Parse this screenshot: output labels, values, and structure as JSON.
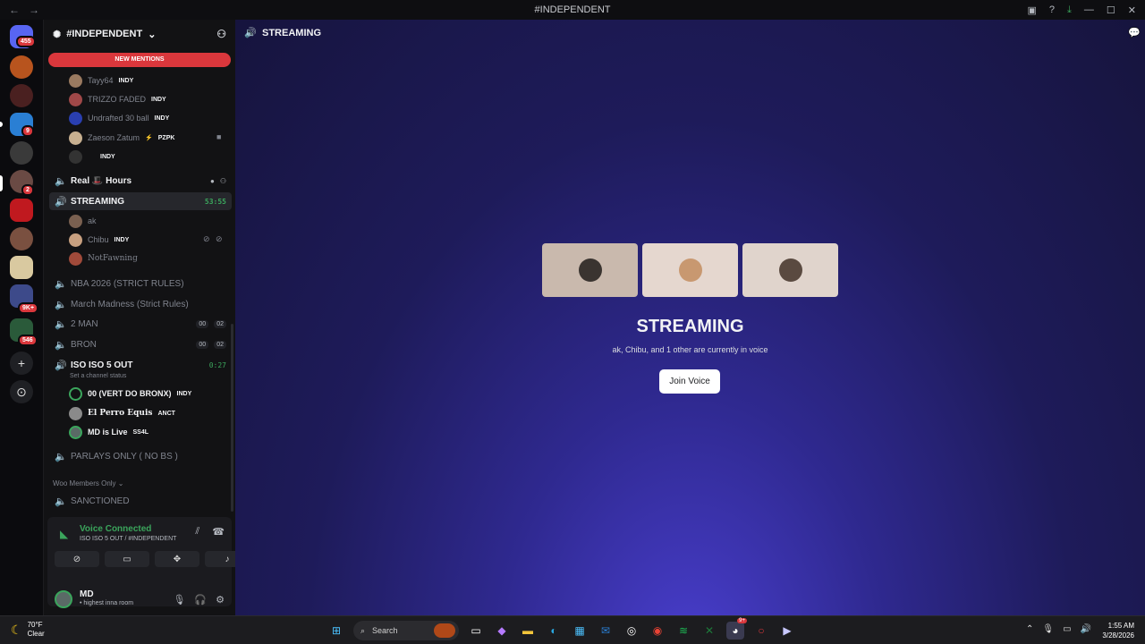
{
  "window": {
    "title": "#INDEPENDENT",
    "nav_back": "←",
    "nav_forward": "→",
    "icons": [
      "screen-share-icon",
      "help-icon",
      "download-icon",
      "minimize-icon",
      "maximize-icon",
      "close-icon"
    ],
    "controls": [
      "?",
      "⤓",
      "—",
      "☐",
      "✕"
    ]
  },
  "servers": {
    "badges": [
      "455",
      "9",
      "2",
      "9K+",
      "546"
    ],
    "add_label": "+",
    "discover_label": "⊙"
  },
  "guild": {
    "name": "#INDEPENDENT",
    "new_mentions": "NEW MENTIONS"
  },
  "top_users": [
    {
      "name": "Tayy64",
      "tag": "INDY"
    },
    {
      "name": "TRIZZO FADED",
      "tag": "INDY"
    },
    {
      "name": "Undrafted 30 ball",
      "tag": "INDY"
    },
    {
      "name": "Zaeson Zatum",
      "tag": "PZPK"
    },
    {
      "name": "",
      "tag": "INDY"
    }
  ],
  "channels": {
    "real_hours": "Real 🎩 Hours",
    "streaming": {
      "name": "STREAMING",
      "timer": "53:55"
    },
    "streaming_users": [
      {
        "name": "ak",
        "tag": ""
      },
      {
        "name": "Chibu",
        "tag": "INDY"
      },
      {
        "name": "NotFawning",
        "tag": ""
      }
    ],
    "nba": "NBA 2026 (STRICT RULES)",
    "march": "March Madness (Strict Rules)",
    "two_man": {
      "name": "2 MAN",
      "a": "00",
      "b": "02"
    },
    "bron": {
      "name": "BRON",
      "a": "00",
      "b": "02"
    },
    "iso": {
      "name": "ISO ISO 5 OUT",
      "timer": "0:27",
      "status": "Set a channel status"
    },
    "iso_users": [
      {
        "name": "00 (VERT DO BRONX)",
        "tag": "INDY"
      },
      {
        "name": "El Perro Equis",
        "tag": "ANCT"
      },
      {
        "name": "MD is Live",
        "tag": "SS4L"
      }
    ],
    "parlays": "PARLAYS ONLY ( NO BS )",
    "category_woo": "Woo Members Only",
    "sanctioned": "SANCTIONED"
  },
  "voice": {
    "title": "Voice Connected",
    "sub": "ISO ISO 5 OUT / #INDEPENDENT"
  },
  "user": {
    "name": "MD",
    "status": "• highest inna room"
  },
  "main": {
    "channel": "STREAMING",
    "title": "STREAMING",
    "subtitle": "ak, Chibu, and 1 other are currently in voice",
    "join": "Join Voice",
    "tile_colors": [
      "#c9b9ad",
      "#e5d7cf",
      "#e0d4cc"
    ]
  },
  "taskbar": {
    "temp": "70°F",
    "condition": "Clear",
    "search": "Search",
    "time": "1:55 AM",
    "date": "3/28/2026",
    "discord_badge": "9+"
  },
  "colors": {
    "accent_green": "#3ba55c",
    "mention_red": "#da373c"
  }
}
